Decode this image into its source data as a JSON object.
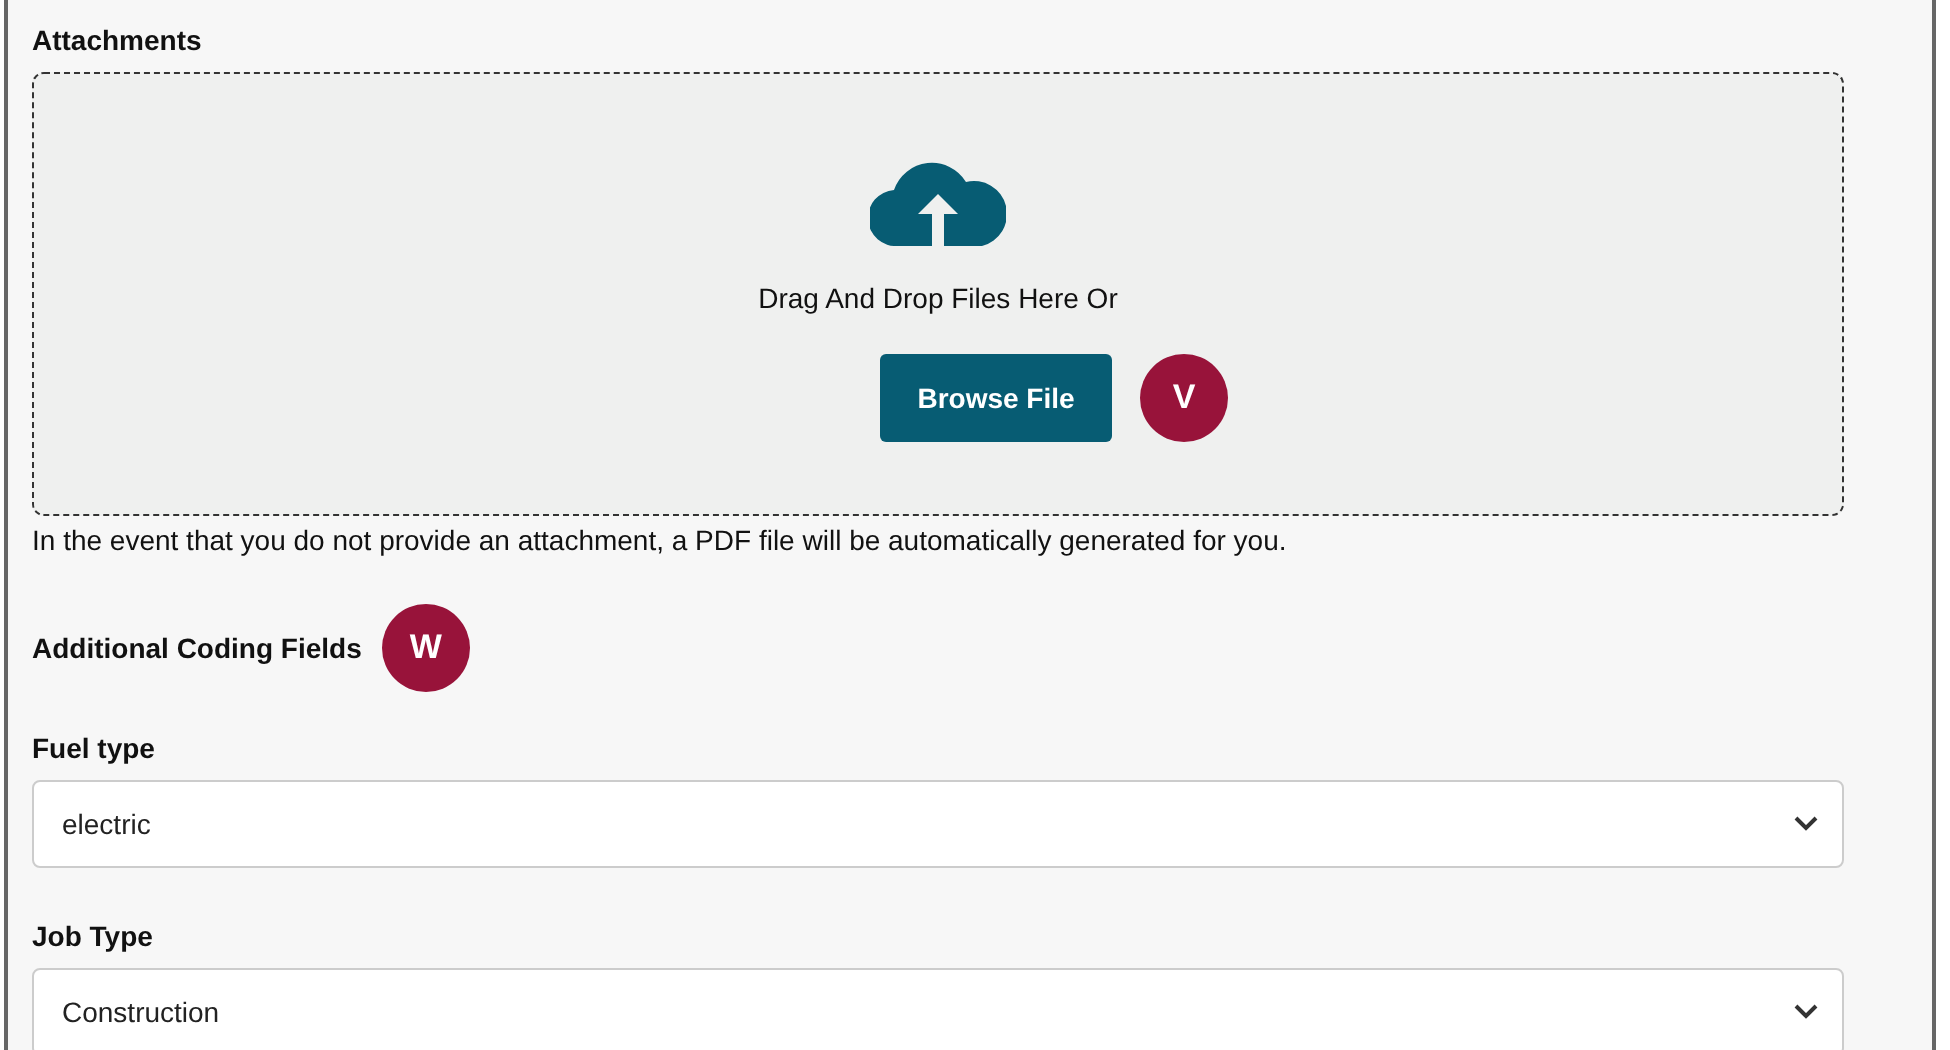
{
  "attachments": {
    "title": "Attachments",
    "dropzone": {
      "prompt": "Drag And Drop Files Here Or",
      "button": "Browse File",
      "callout": "V"
    },
    "note": "In the event that you do not provide an attachment, a PDF file will be automatically generated for you."
  },
  "coding_fields": {
    "title": "Additional Coding Fields",
    "callout": "W",
    "fields": [
      {
        "label": "Fuel type",
        "value": "electric"
      },
      {
        "label": "Job Type",
        "value": "Construction"
      }
    ]
  }
}
